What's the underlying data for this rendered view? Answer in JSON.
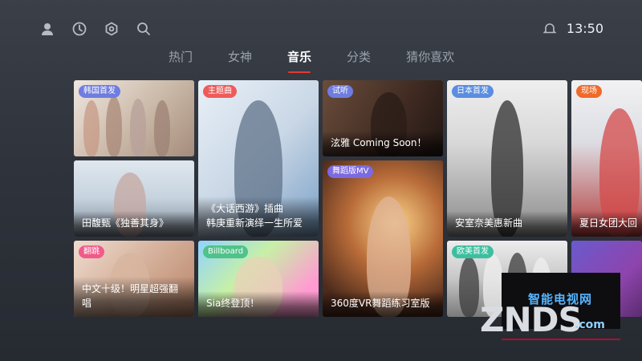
{
  "header": {
    "icons": [
      "user-icon",
      "history-icon",
      "settings-icon",
      "search-icon"
    ],
    "status_icon": "notification-icon",
    "time": "13:50"
  },
  "tabs": [
    {
      "label": "热门",
      "active": false
    },
    {
      "label": "女神",
      "active": false
    },
    {
      "label": "音乐",
      "active": true
    },
    {
      "label": "分类",
      "active": false
    },
    {
      "label": "猜你喜欢",
      "active": false
    }
  ],
  "cards": [
    {
      "badge": "韩国首发",
      "badge_color": "#6f7de0",
      "caption": ""
    },
    {
      "badge": "",
      "badge_color": "",
      "caption": "田馥甄《独善其身》"
    },
    {
      "badge": "主题曲",
      "badge_color": "#ef5b5b",
      "caption": "《大话西游》插曲\n韩庚重新演绎一生所爱"
    },
    {
      "badge": "试听",
      "badge_color": "#6f7de0",
      "caption": "泫雅 Coming Soon！"
    },
    {
      "badge": "舞蹈版MV",
      "badge_color": "#7c6ae0",
      "caption": "360度VR舞蹈练习室版"
    },
    {
      "badge": "日本首发",
      "badge_color": "#5b8de0",
      "caption": "安室奈美惠新曲"
    },
    {
      "badge": "翻跳",
      "badge_color": "#ef5b8a",
      "caption": "中文十级！明星超强翻唱"
    },
    {
      "badge": "Billboard",
      "badge_color": "#50c28a",
      "caption": "Sia终登顶！"
    },
    {
      "badge": "欧美首发",
      "badge_color": "#3dbf9f",
      "caption": ""
    },
    {
      "badge": "现场",
      "badge_color": "#ef6a2b",
      "caption": "夏日女团大回"
    },
    {
      "badge": "",
      "badge_color": "",
      "caption": ""
    }
  ],
  "watermark": {
    "cn": "智能电视网",
    "en": "ZNDS",
    "com": ".com"
  }
}
